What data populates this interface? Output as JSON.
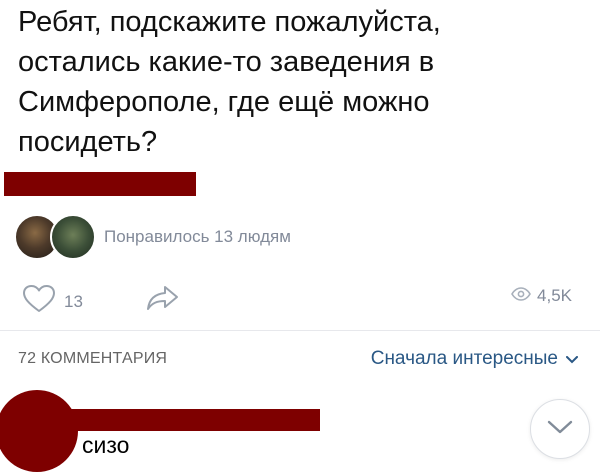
{
  "post": {
    "text": "Ребят, подскажите пожалуйста,\nостались какие-то заведения в\nСимферополе, где ещё можно\nпосидеть?",
    "likes_text": "Понравилось 13 людям"
  },
  "actions": {
    "like_count": "13",
    "views_count": "4,5K"
  },
  "comments": {
    "count_label": "72 КОММЕНТАРИЯ",
    "sort_label": "Сначала интересные",
    "first_comment_text": "сизо"
  },
  "colors": {
    "redaction": "#7e0000",
    "link": "#2a5885",
    "muted": "#828a99"
  },
  "icons": [
    "heart-icon",
    "share-arrow-icon",
    "eye-icon",
    "chevron-down-icon"
  ]
}
